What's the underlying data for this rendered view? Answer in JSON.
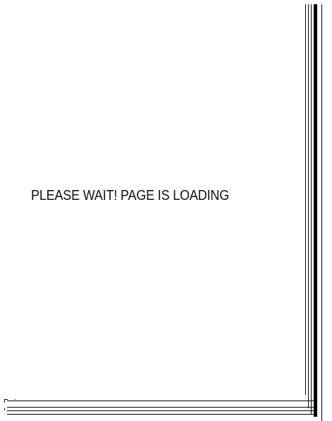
{
  "page": {
    "message": "PLEASE  WAIT!  PAGE  IS LOADING"
  },
  "colors": {
    "background": "#ffffff",
    "text": "#111111",
    "frame": "#000000"
  }
}
